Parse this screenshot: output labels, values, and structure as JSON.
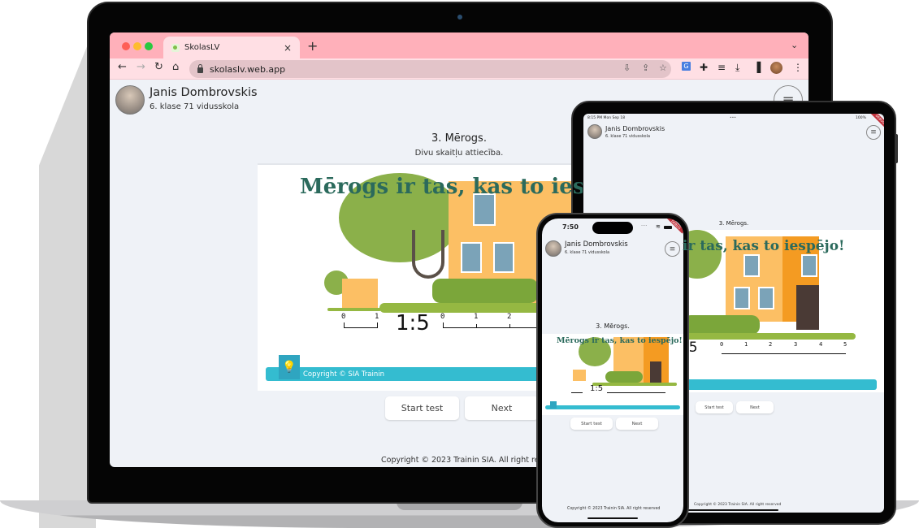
{
  "browser": {
    "tab_title": "SkolasLV",
    "tab_close": "×",
    "new_tab": "+",
    "tab_list_icon": "⌄",
    "url": "skolaslv.web.app",
    "nav": {
      "back": "←",
      "forward": "→",
      "reload": "↻",
      "home": "⌂"
    },
    "omnibox_icons": {
      "install": "⇩",
      "share": "⇪",
      "bookmark": "☆"
    },
    "toolbar_icons": {
      "translate": "G",
      "extensions": "✚",
      "media": "≡",
      "downloads": "⤓",
      "side_panel": "▐",
      "menu": "⋮"
    }
  },
  "user": {
    "name": "Janis Dombrovskis",
    "class": "6. klase 71 vidusskola"
  },
  "menu_icon": "≡",
  "lesson": {
    "title": "3. Mērogs.",
    "subtitle": "Divu skaitļu attiecība."
  },
  "slide": {
    "headline": "Mērogs ir tas, kas to iespējo!",
    "headline_partial": "Mērogs ir tas, kas to iesp",
    "ratio": "1:5",
    "small_ruler_ticks": [
      "0",
      "1"
    ],
    "large_ruler_ticks": [
      "0",
      "1",
      "2",
      "3",
      "4",
      "5"
    ],
    "copyright_band": "Copyright  © SIA Trainin",
    "logo_icon": "💡"
  },
  "buttons": {
    "start_test": "Start test",
    "next": "Next"
  },
  "footer": "Copyright © 2023 Trainin SIA. All right reserved",
  "ipad": {
    "status_time": "8:15 PM  Mon Sep 18",
    "status_dots": "•••",
    "status_right": "100%",
    "debug_ribbon": "DEBUG"
  },
  "phone": {
    "status_time": "7:50",
    "status_right": "····",
    "debug_ribbon": "DEBUG"
  },
  "colors": {
    "tabbar": "#ffb0ba",
    "toolbar": "#ffdfe4",
    "page_bg": "#eff2f7",
    "headline": "#2b6a5c",
    "copyright_band": "#34bcd0",
    "traffic_red": "#fe5f57",
    "traffic_yellow": "#febc2e",
    "traffic_green": "#28c840"
  }
}
